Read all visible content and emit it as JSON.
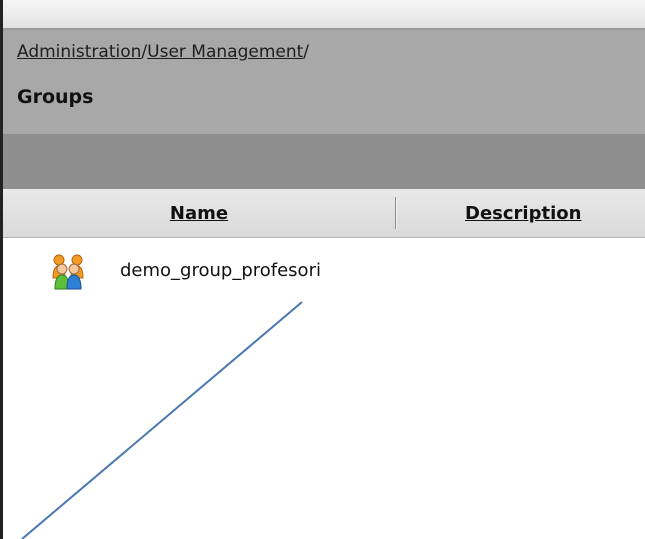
{
  "breadcrumb": {
    "items": [
      {
        "label": "Administration"
      },
      {
        "label": "User Management"
      }
    ],
    "separator": "/"
  },
  "page": {
    "title": "Groups"
  },
  "table": {
    "columns": [
      {
        "label": "Name"
      },
      {
        "label": "Description"
      }
    ],
    "rows": [
      {
        "name": "demo_group_profesori",
        "description": "",
        "icon": "user-group-icon"
      }
    ]
  },
  "colors": {
    "header_panel": "#a8a8a8",
    "toolbar_band": "#8e8e8e",
    "annotation_line": "#4a77b0"
  }
}
